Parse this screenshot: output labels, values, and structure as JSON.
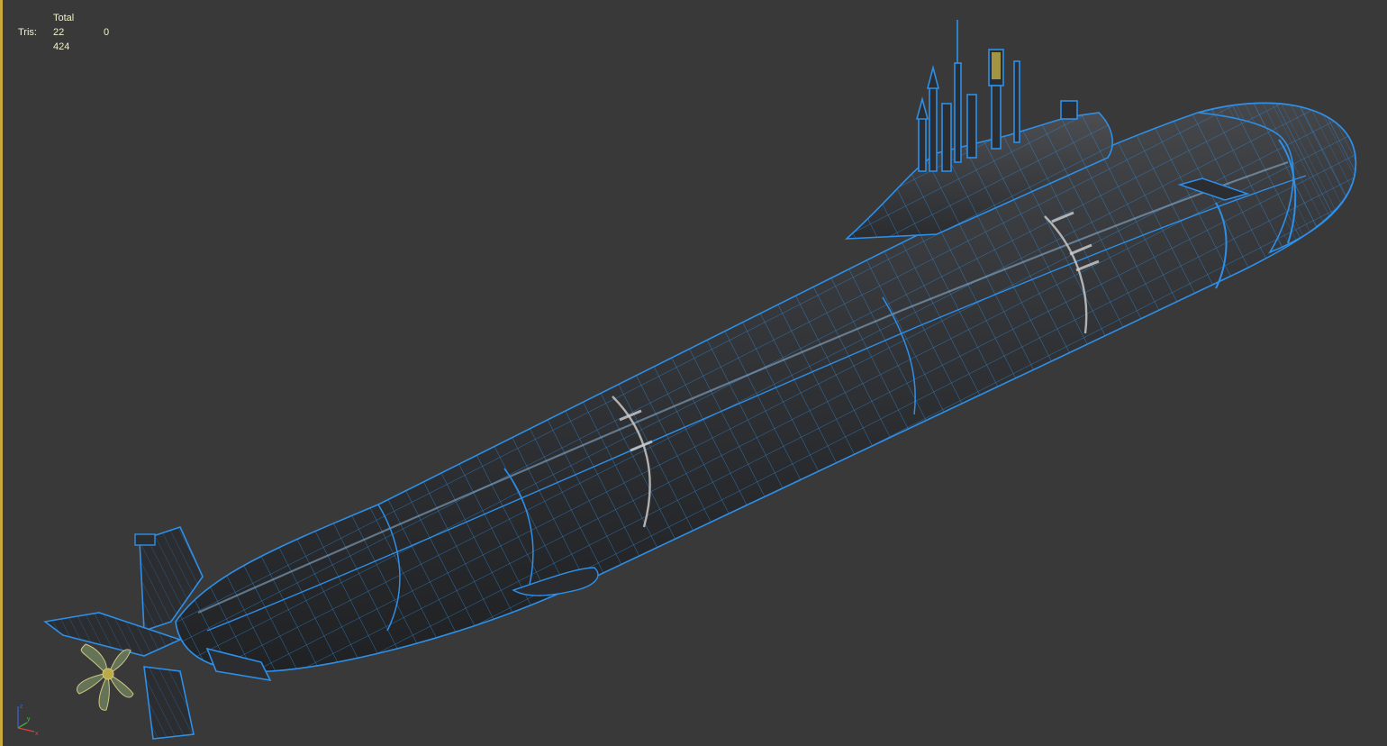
{
  "stats": {
    "header": "Total",
    "tris_label": "Tris:",
    "tris_value": "22 424",
    "selected_value": "0"
  },
  "gizmo": {
    "x_label": "x",
    "y_label": "y",
    "z_label": "z"
  },
  "colors": {
    "viewport_bg": "#393939",
    "wireframe": "#2e8fe8",
    "hull_dark": "#27292c",
    "hull_mid": "#4a4a4a",
    "stats_text": "#f2f2c8",
    "border_accent": "#c9a93a"
  }
}
